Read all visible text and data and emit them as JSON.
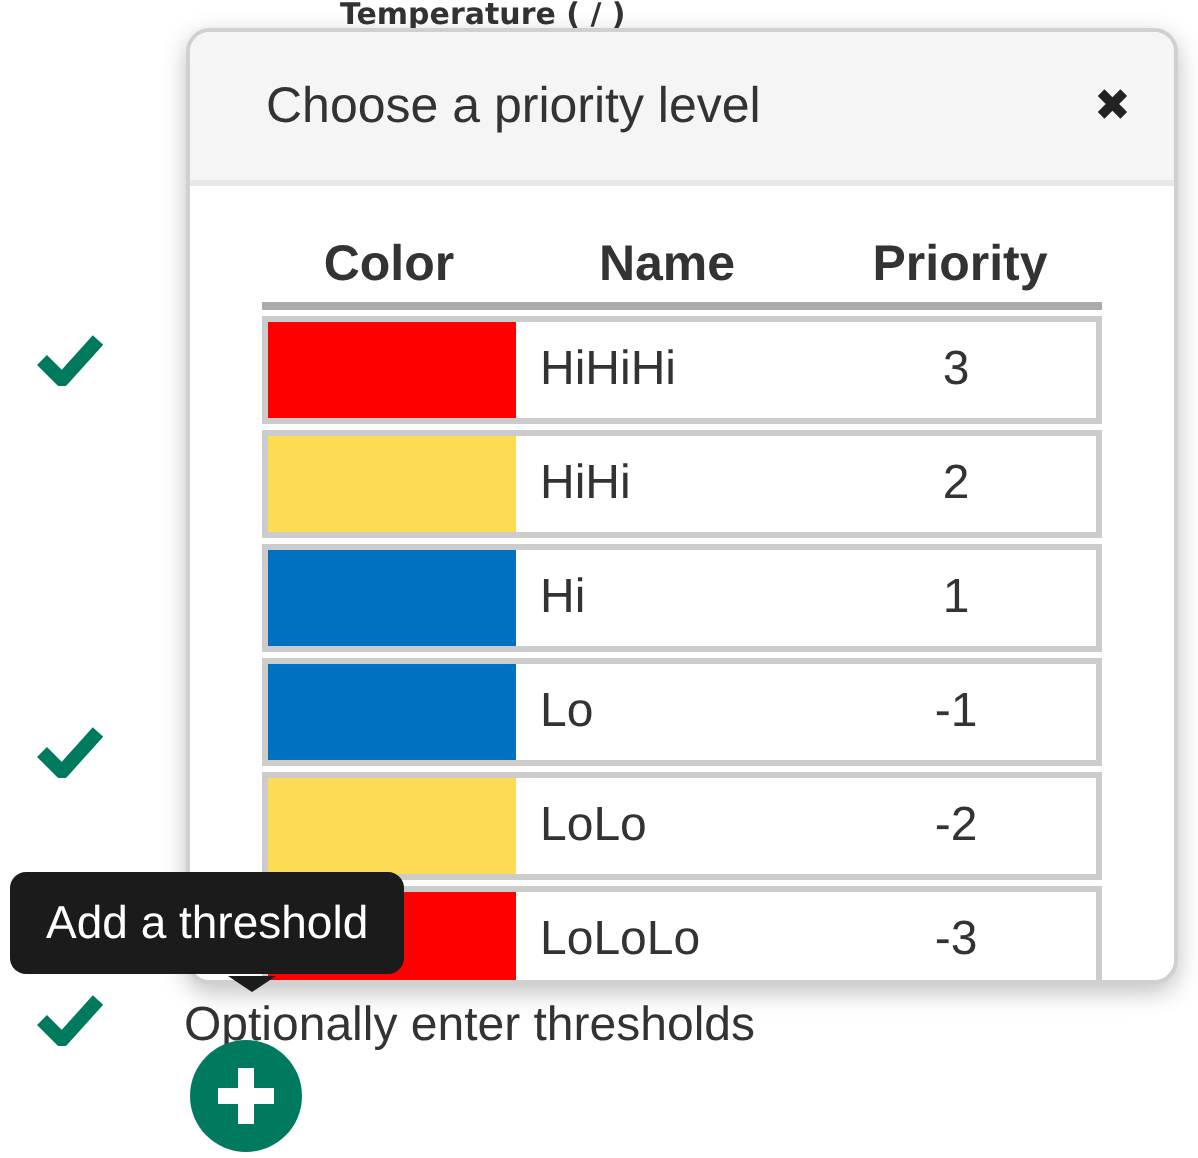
{
  "section": {
    "title": "Temperature ( / )"
  },
  "steps": [
    {
      "done": true
    },
    {
      "done": true
    },
    {
      "done": true,
      "label": "Optionally enter thresholds"
    }
  ],
  "dialog": {
    "title": "Choose a priority level",
    "close": "✖",
    "columns": [
      "Color",
      "Name",
      "Priority"
    ],
    "rows": [
      {
        "color": "#ff0000",
        "name": "HiHiHi",
        "priority": "3"
      },
      {
        "color": "#fddb55",
        "name": "HiHi",
        "priority": "2"
      },
      {
        "color": "#0070c0",
        "name": "Hi",
        "priority": "1"
      },
      {
        "color": "#0070c0",
        "name": "Lo",
        "priority": "-1"
      },
      {
        "color": "#fddb55",
        "name": "LoLo",
        "priority": "-2"
      },
      {
        "color": "#ff0000",
        "name": "LoLoLo",
        "priority": "-3"
      }
    ]
  },
  "tooltip": {
    "text": "Add a threshold"
  }
}
